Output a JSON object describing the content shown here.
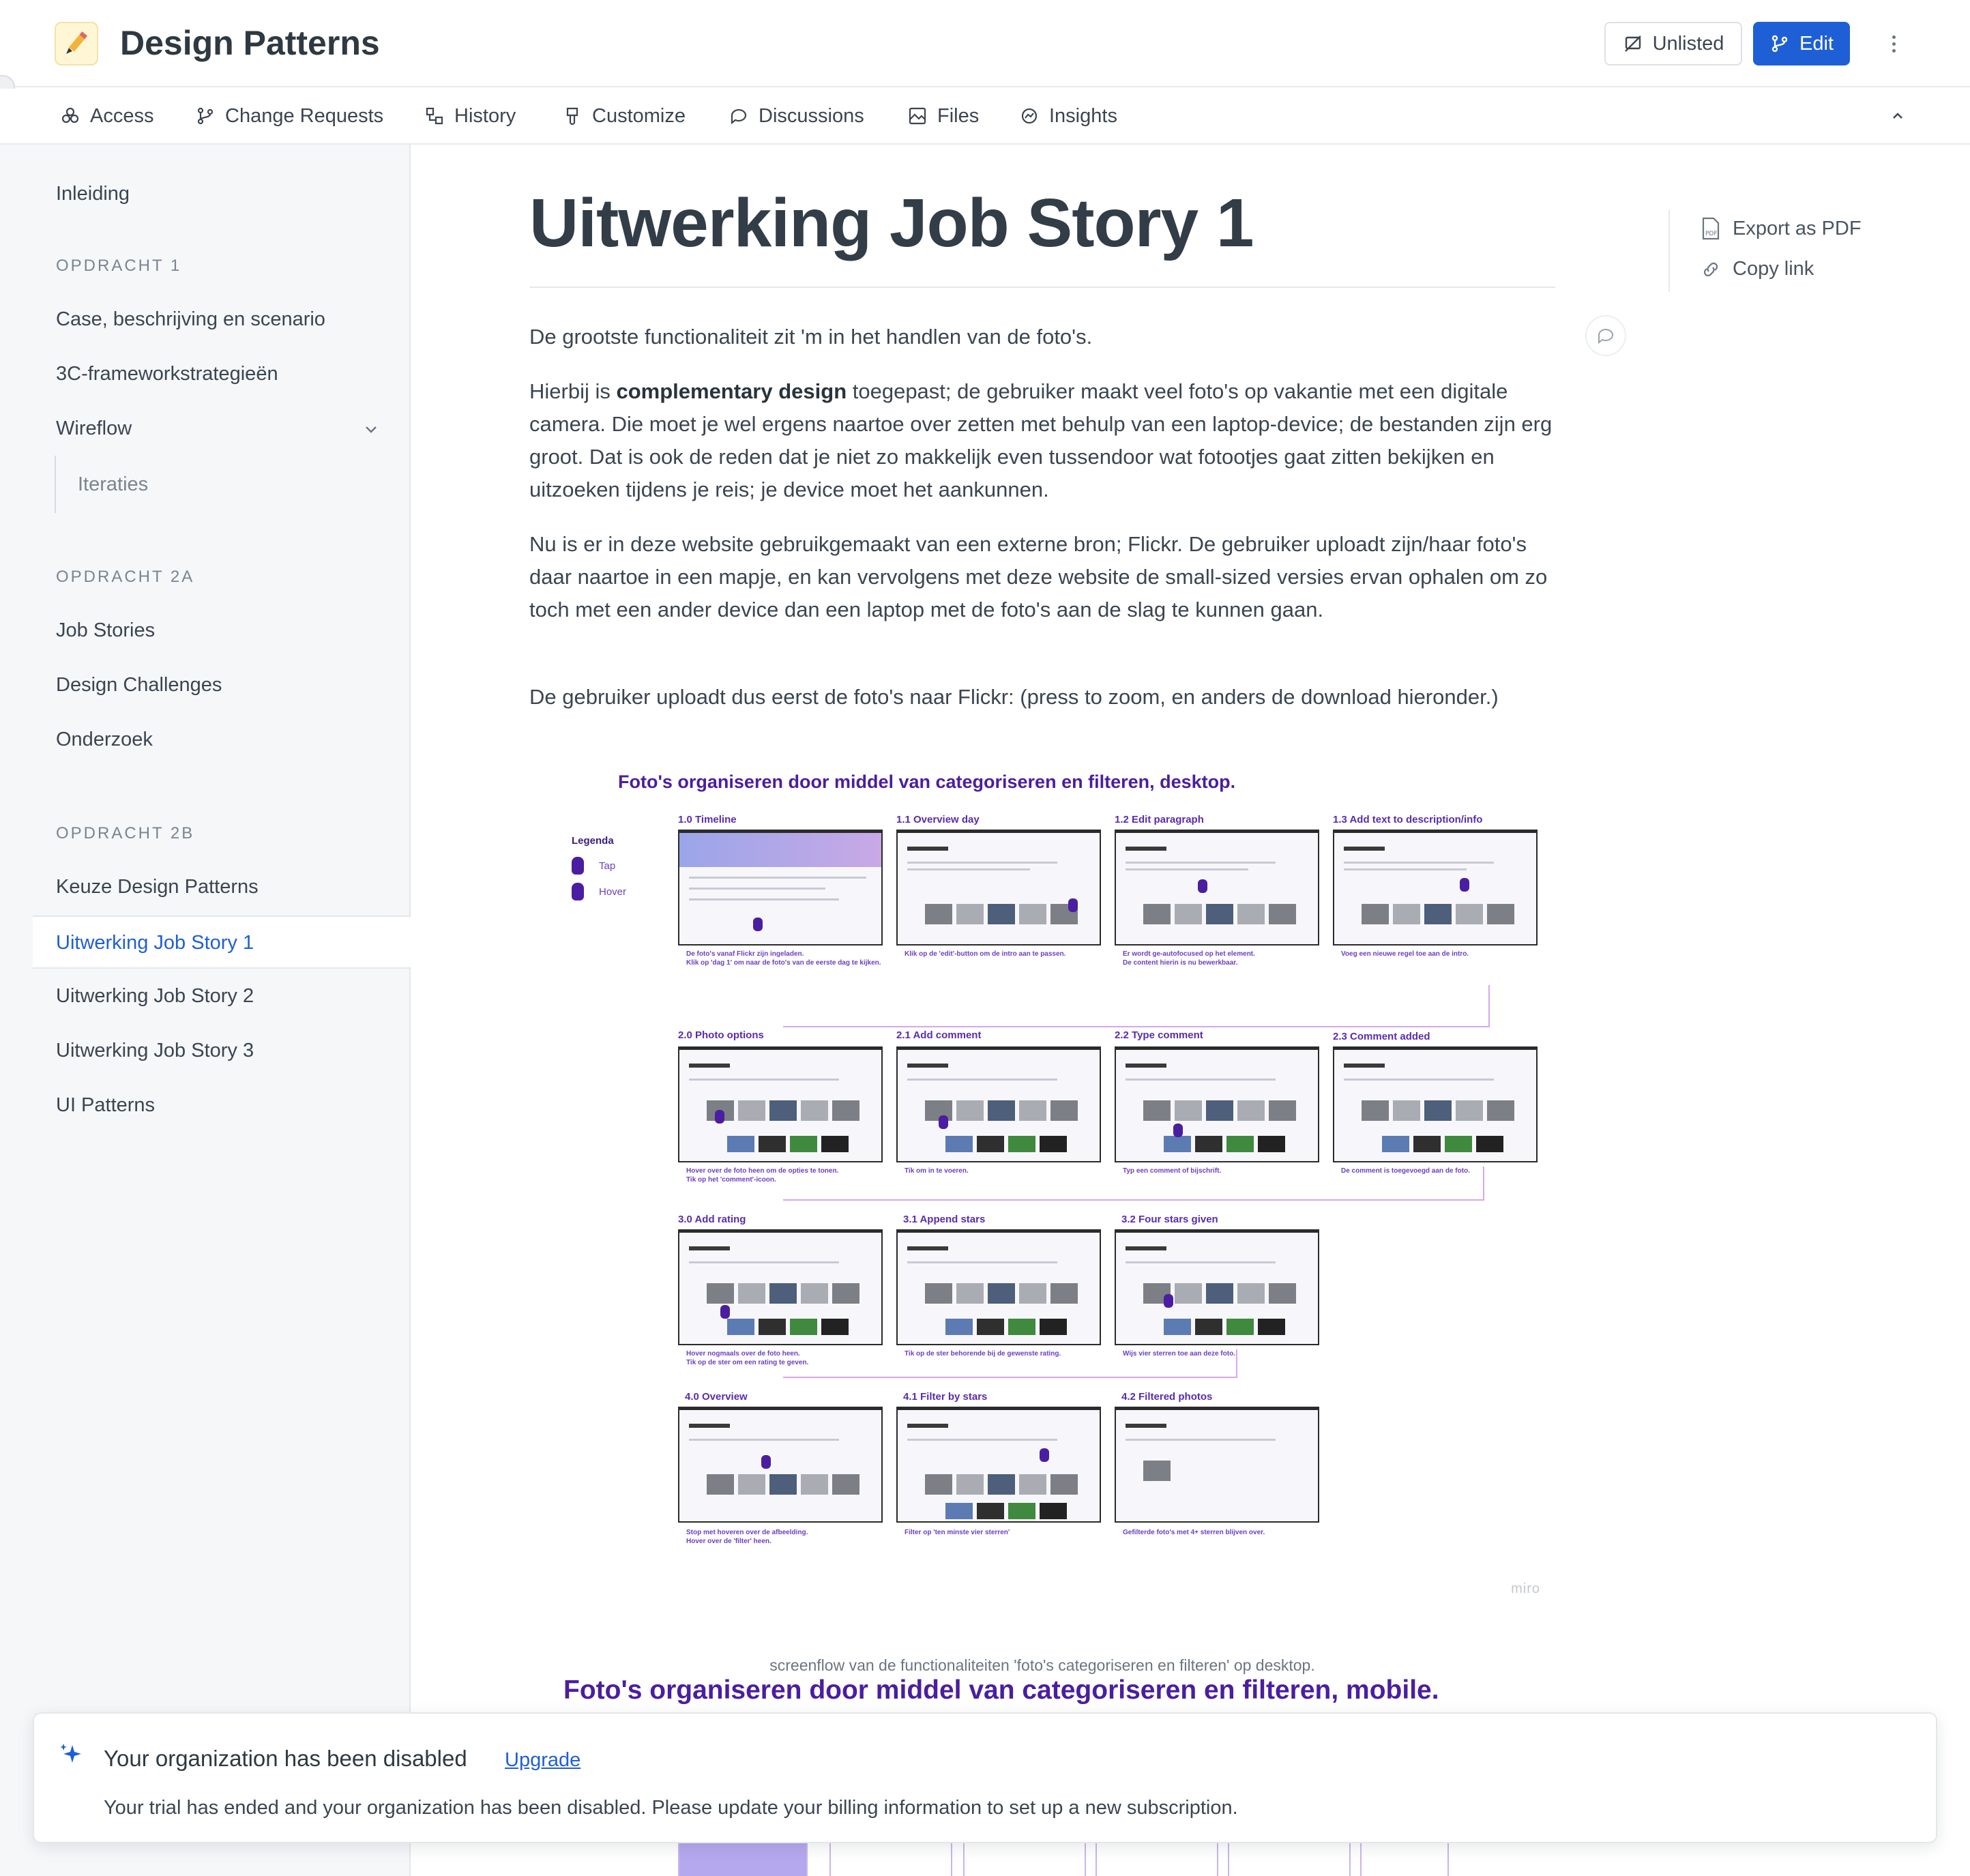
{
  "header": {
    "space_logo": "pencil-emoji",
    "space_title": "Design Patterns",
    "unlisted_label": "Unlisted",
    "edit_label": "Edit"
  },
  "tabs": [
    {
      "label": "Access",
      "icon": "access-icon"
    },
    {
      "label": "Change Requests",
      "icon": "branch-icon"
    },
    {
      "label": "History",
      "icon": "history-icon"
    },
    {
      "label": "Customize",
      "icon": "brush-icon"
    },
    {
      "label": "Discussions",
      "icon": "chat-icon"
    },
    {
      "label": "Files",
      "icon": "image-icon"
    },
    {
      "label": "Insights",
      "icon": "insights-icon"
    }
  ],
  "sidebar": {
    "intro": "Inleiding",
    "section1": "OPDRACHT 1",
    "s1_items": [
      "Case, beschrijving en scenario",
      "3C-frameworkstrategieën",
      "Wireflow"
    ],
    "s1_sub": "Iteraties",
    "section2a": "OPDRACHT 2A",
    "s2a_items": [
      "Job Stories",
      "Design Challenges",
      "Onderzoek"
    ],
    "section2b": "OPDRACHT 2B",
    "s2b_items": [
      "Keuze Design Patterns",
      "Uitwerking Job Story 1",
      "Uitwerking Job Story 2",
      "Uitwerking Job Story 3",
      "UI Patterns"
    ]
  },
  "page": {
    "title": "Uitwerking Job Story 1",
    "p1": "De grootste functionaliteit zit 'm in het handlen van de foto's.",
    "p2_pre": "Hierbij is ",
    "p2_bold": "complementary design",
    "p2_post": " toegepast; de gebruiker maakt veel foto's op vakantie met een digitale camera. Die moet je wel ergens naartoe over zetten met behulp van een laptop-device; de bestanden zijn erg groot. Dat is ook de reden dat je niet zo makkelijk even tussendoor wat fotootjes gaat zitten bekijken en uitzoeken tijdens je reis; je device moet het aankunnen.",
    "p3": "Nu is er in deze website gebruikgemaakt van een externe bron; Flickr. De gebruiker uploadt zijn/haar foto's daar naartoe in een mapje, en kan vervolgens met deze website de small-sized versies ervan ophalen om zo toch met een ander device dan een laptop met de foto's aan de slag te kunnen gaan.",
    "p4": "De gebruiker uploadt dus eerst de foto's naar Flickr: (press to zoom, en anders de download hieronder.)",
    "export_pdf": "Export as PDF",
    "copy_link": "Copy link"
  },
  "board": {
    "title": "Foto's organiseren door middel van categoriseren en filteren, desktop.",
    "legend_title": "Legenda",
    "legend_tap": "Tap",
    "legend_hover": "Hover",
    "steps": [
      {
        "label": "1.0 Timeline",
        "caption": "De foto's vanaf Flickr zijn ingeladen.\nKlik op 'dag 1' om naar de foto's van de eerste dag te kijken."
      },
      {
        "label": "1.1 Overview day",
        "caption": "Klik op de 'edit'-button om de intro aan te passen."
      },
      {
        "label": "1.2 Edit paragraph",
        "caption": "Er wordt ge-autofocused op het element.\nDe content hierin is nu bewerkbaar."
      },
      {
        "label": "1.3 Add text to description/info",
        "caption": "Voeg een nieuwe regel toe aan de intro."
      },
      {
        "label": "2.0 Photo options",
        "caption": "Hover over de foto heen om de opties te tonen.\nTik op het 'comment'-icoon."
      },
      {
        "label": "2.1 Add comment",
        "caption": "Tik om in te voeren."
      },
      {
        "label": "2.2 Type comment",
        "caption": "Typ een comment of bijschrift."
      },
      {
        "label": "2.3 Comment added",
        "caption": "De comment is toegevoegd aan de foto."
      },
      {
        "label": "3.0 Add rating",
        "caption": "Hover nogmaals over de foto heen.\nTik op de ster om een rating te geven."
      },
      {
        "label": "3.1 Append stars",
        "caption": "Tik op de ster behorende bij de gewenste rating."
      },
      {
        "label": "3.2 Four stars given",
        "caption": "Wijs vier sterren toe aan deze foto."
      },
      {
        "label": "4.0 Overview",
        "caption": "Stop met hoveren over de afbeelding.\nHover over de 'filter' heen."
      },
      {
        "label": "4.1 Filter by stars",
        "caption": "Filter op 'ten minste vier sterren'"
      },
      {
        "label": "4.2 Filtered photos",
        "caption": "Gefilterde foto's met 4+ sterren blijven over."
      }
    ],
    "watermark": "miro",
    "caption": "screenflow van de functionaliteiten 'foto's categoriseren en filteren' op desktop."
  },
  "section2_title": "Foto's organiseren door middel van categoriseren en filteren, mobile.",
  "toast": {
    "title": "Your organization has been disabled",
    "link": "Upgrade",
    "body": "Your trial has ended and your organization has been disabled. Please update your billing information to set up a new subscription."
  },
  "colors": {
    "accent": "#1f5fd6",
    "board_purple": "#4a1ea0",
    "sidebar_bg": "#f5f7f9"
  }
}
